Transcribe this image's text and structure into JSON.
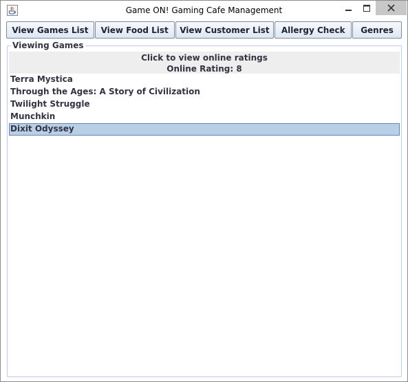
{
  "window": {
    "title": "Game ON! Gaming Cafe Management"
  },
  "toolbar": {
    "buttons": [
      {
        "label": "View Games List"
      },
      {
        "label": "View Food List"
      },
      {
        "label": "View Customer List"
      },
      {
        "label": "Allergy Check"
      },
      {
        "label": "Genres"
      }
    ]
  },
  "panel": {
    "title": "Viewing Games",
    "info_line1": "Click to view online ratings",
    "info_line2": "Online Rating: 8"
  },
  "games": {
    "items": [
      {
        "label": "Terra Mystica",
        "selected": false
      },
      {
        "label": "Through the Ages: A Story of Civilization",
        "selected": false
      },
      {
        "label": "Twilight Struggle",
        "selected": false
      },
      {
        "label": "Munchkin",
        "selected": false
      },
      {
        "label": "Dixit Odyssey",
        "selected": true
      }
    ]
  },
  "colors": {
    "selection_fill": "#b8cfe5",
    "selection_border": "#6382bf",
    "button_border": "#7a8a9a"
  }
}
